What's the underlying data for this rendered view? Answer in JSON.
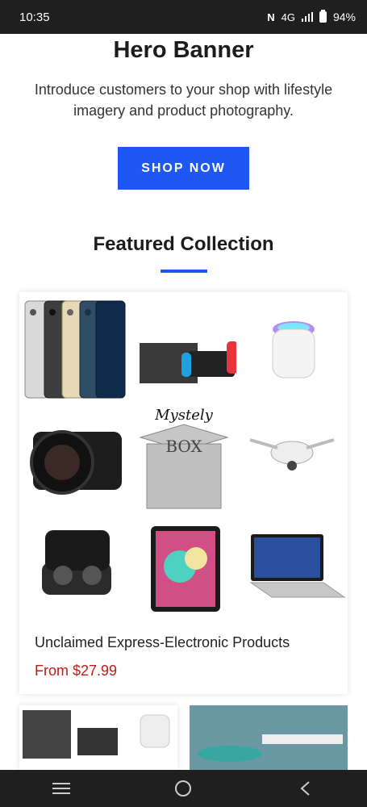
{
  "status_bar": {
    "time": "10:35",
    "network": "4G",
    "battery": "94%"
  },
  "hero": {
    "title": "Hero Banner",
    "text": "Introduce customers to your shop with lifestyle imagery and product photography.",
    "button_label": "SHOP NOW"
  },
  "featured": {
    "title": "Featured Collection",
    "product": {
      "title": "Unclaimed Express-Electronic Products",
      "price": "From $27.99",
      "image_caption": "Mystely",
      "box_text": "BOX"
    }
  },
  "colors": {
    "accent": "#1f57f2",
    "price": "#c21b17",
    "bars": "#1f1f1f"
  },
  "icons": [
    "nfc-icon",
    "signal-icon",
    "battery-icon",
    "menu-icon",
    "home-icon",
    "back-icon"
  ]
}
